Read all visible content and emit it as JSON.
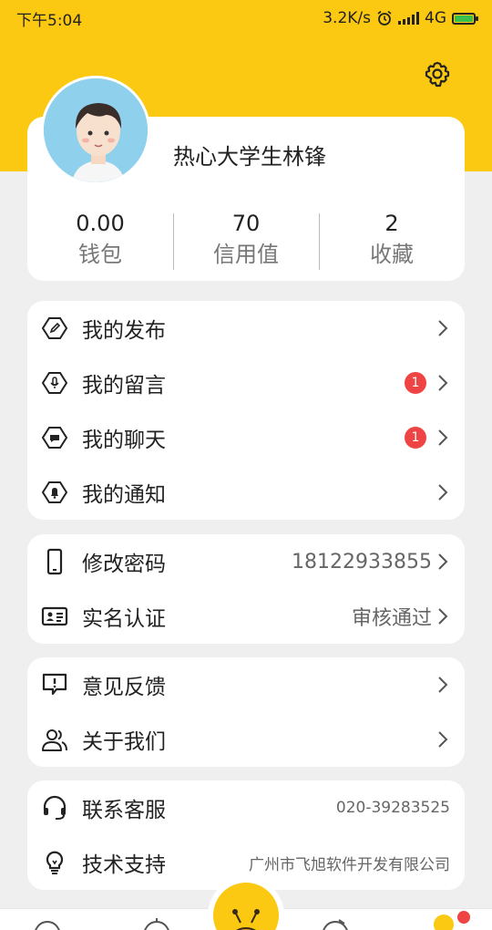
{
  "status_bar": {
    "time": "下午5:04",
    "speed": "3.2K/s",
    "network": "4G"
  },
  "profile": {
    "username": "热心大学生林锋",
    "stats": [
      {
        "value": "0.00",
        "label": "钱包"
      },
      {
        "value": "70",
        "label": "信用值"
      },
      {
        "value": "2",
        "label": "收藏"
      }
    ]
  },
  "menu_group_1": [
    {
      "label": "我的发布",
      "badge": ""
    },
    {
      "label": "我的留言",
      "badge": "1"
    },
    {
      "label": "我的聊天",
      "badge": "1"
    },
    {
      "label": "我的通知",
      "badge": ""
    }
  ],
  "menu_group_2": [
    {
      "label": "修改密码",
      "value": "18122933855"
    },
    {
      "label": "实名认证",
      "value": "审核通过"
    }
  ],
  "menu_group_3": [
    {
      "label": "意见反馈"
    },
    {
      "label": "关于我们"
    }
  ],
  "menu_group_4": [
    {
      "label": "联系客服",
      "value": "020-39283525"
    },
    {
      "label": "技术支持",
      "value": "广州市飞旭软件开发有限公司"
    }
  ],
  "colors": {
    "brand_yellow": "#fbc911",
    "badge_red": "#ef4444",
    "background": "#efefef"
  },
  "icons": [
    "settings-gear-icon",
    "edit-hexagon-icon",
    "mic-hexagon-icon",
    "chat-hexagon-icon",
    "bell-hexagon-icon",
    "phone-icon",
    "id-card-icon",
    "feedback-icon",
    "users-icon",
    "headset-icon",
    "bulb-icon"
  ]
}
